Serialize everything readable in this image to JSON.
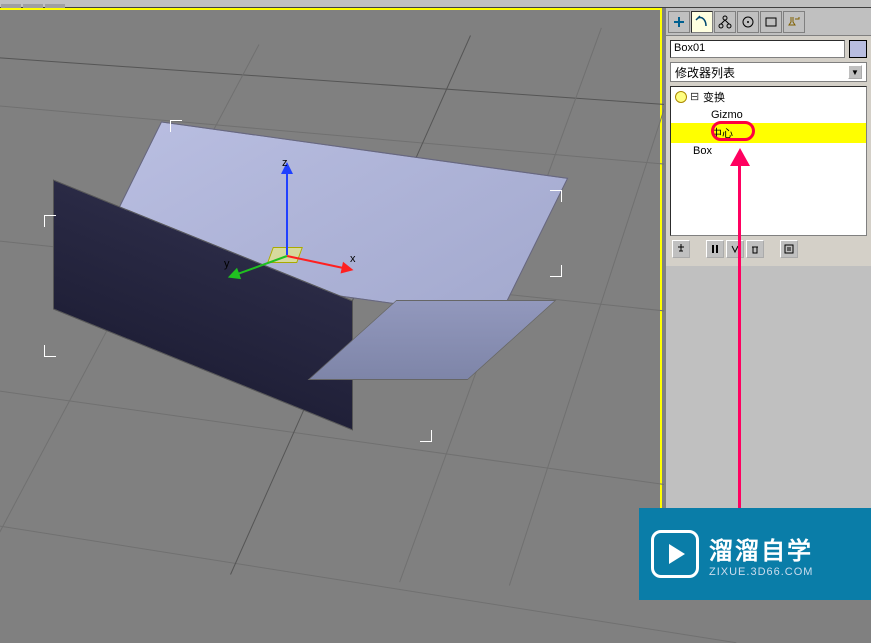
{
  "toolbar": {
    "items": [
      "",
      "",
      "",
      "",
      "",
      ""
    ]
  },
  "object": {
    "name": "Box01"
  },
  "modifier_dropdown": {
    "label": "修改器列表"
  },
  "stack": {
    "items": [
      {
        "label": "变换",
        "type": "modifier"
      },
      {
        "label": "Gizmo",
        "type": "sub"
      },
      {
        "label": "中心",
        "type": "sub",
        "selected": true
      },
      {
        "label": "Box",
        "type": "base"
      }
    ]
  },
  "gizmo": {
    "axis_x": "x",
    "axis_y": "y",
    "axis_z": "z"
  },
  "watermark": {
    "title": "溜溜自学",
    "url": "ZIXUE.3D66.COM"
  }
}
